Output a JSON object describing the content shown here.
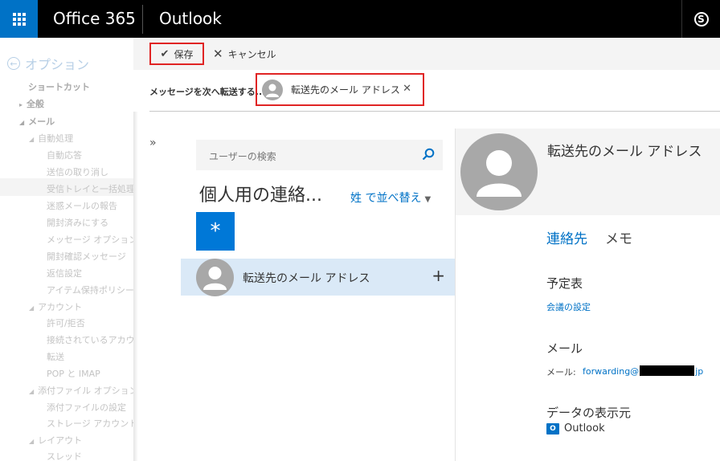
{
  "header": {
    "brand": "Office 365",
    "app_name": "Outlook",
    "skype_letter": "S",
    "accent": "#0072c6"
  },
  "sidebar": {
    "back_label": "オプション",
    "items": [
      {
        "label": "ショートカット",
        "bold": true
      },
      {
        "label": "全般",
        "bold": true
      },
      {
        "label": "メール",
        "bold": true
      },
      {
        "label": "自動処理"
      },
      {
        "label": "自動応答"
      },
      {
        "label": "送信の取り消し"
      },
      {
        "label": "受信トレイと一括処理ルール"
      },
      {
        "label": "迷惑メールの報告"
      },
      {
        "label": "開封済みにする"
      },
      {
        "label": "メッセージ オプション"
      },
      {
        "label": "開封確認メッセージ"
      },
      {
        "label": "返信設定"
      },
      {
        "label": "アイテム保持ポリシー"
      },
      {
        "label": "アカウント"
      },
      {
        "label": "許可/拒否"
      },
      {
        "label": "接続されているアカウント"
      },
      {
        "label": "転送"
      },
      {
        "label": "POP と IMAP"
      },
      {
        "label": "添付ファイル オプション"
      },
      {
        "label": "添付ファイルの設定"
      },
      {
        "label": "ストレージ アカウント"
      },
      {
        "label": "レイアウト"
      },
      {
        "label": "スレッド"
      }
    ]
  },
  "toolbar": {
    "save_label": "保存",
    "cancel_label": "キャンセル"
  },
  "forward": {
    "label": "メッセージを次へ転送する...",
    "recipient": "転送先のメール アドレス"
  },
  "people_list": {
    "search_placeholder": "ユーザーの検索",
    "title": "個人用の連絡...",
    "sort_label": "姓 で並べ替え",
    "star_tile": "*",
    "contacts": [
      {
        "name": "転送先のメール アドレス"
      }
    ]
  },
  "detail": {
    "name": "転送先のメール アドレス",
    "tab_contact": "連絡先",
    "tab_notes": "メモ",
    "calendar_title": "予定表",
    "calendar_link": "会議の設定",
    "mail_title": "メール",
    "mail_label": "メール:",
    "mail_prefix": "forwarding@",
    "mail_suffix": "jp",
    "source_title": "データの表示元",
    "source_value": "Outlook"
  }
}
